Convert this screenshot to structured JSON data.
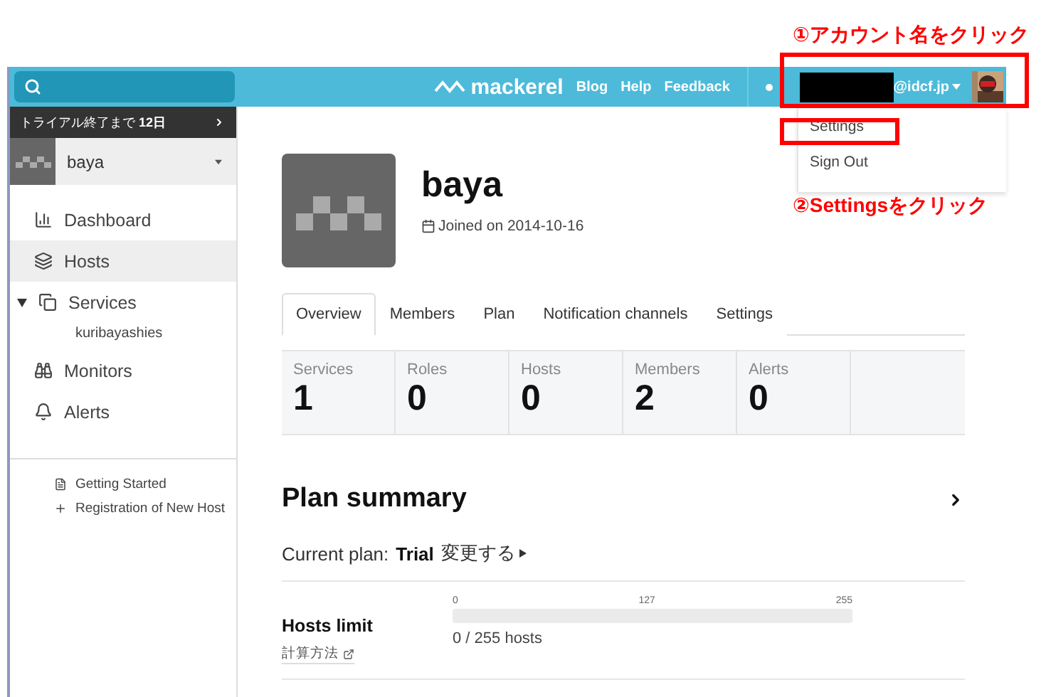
{
  "topbar": {
    "logo": "mackerel",
    "links": [
      "Blog",
      "Help",
      "Feedback"
    ],
    "account": {
      "domain": "@idcf.jp",
      "open": true
    }
  },
  "account_menu": [
    "Settings",
    "Sign Out"
  ],
  "sidebar": {
    "trial": {
      "text": "トライアル終了まで ",
      "days": "12日"
    },
    "organization": "baya",
    "nav": [
      {
        "label": "Dashboard",
        "selected": false
      },
      {
        "label": "Hosts",
        "selected": true
      },
      {
        "label": "Services",
        "selected": false,
        "expanded": true,
        "children": [
          {
            "label": "kuribayashies"
          }
        ]
      },
      {
        "label": "Monitors",
        "selected": false
      },
      {
        "label": "Alerts",
        "selected": false
      }
    ],
    "footer_links": [
      "Getting Started",
      "Registration of New Host"
    ]
  },
  "profile": {
    "name": "baya",
    "joined": "Joined on 2014-10-16"
  },
  "tabs": [
    {
      "label": "Overview",
      "selected": true
    },
    {
      "label": "Members",
      "selected": false
    },
    {
      "label": "Plan",
      "selected": false
    },
    {
      "label": "Notification channels",
      "selected": false
    },
    {
      "label": "Settings",
      "selected": false
    }
  ],
  "stats": [
    {
      "label": "Services",
      "value": "1"
    },
    {
      "label": "Roles",
      "value": "0"
    },
    {
      "label": "Hosts",
      "value": "0"
    },
    {
      "label": "Members",
      "value": "2"
    },
    {
      "label": "Alerts",
      "value": "0"
    }
  ],
  "plan_summary": {
    "title": "Plan summary",
    "current_label": "Current plan:",
    "plan": "Trial",
    "change_link": "変更する",
    "hosts_limit": {
      "title": "Hosts limit",
      "help_link": "計算方法",
      "ticks": [
        "0",
        "127",
        "255"
      ],
      "level": 0,
      "reading": "0 / 255 hosts"
    }
  },
  "annotations": [
    {
      "text": "①アカウント名をクリック"
    },
    {
      "text": "②Settingsをクリック"
    }
  ]
}
